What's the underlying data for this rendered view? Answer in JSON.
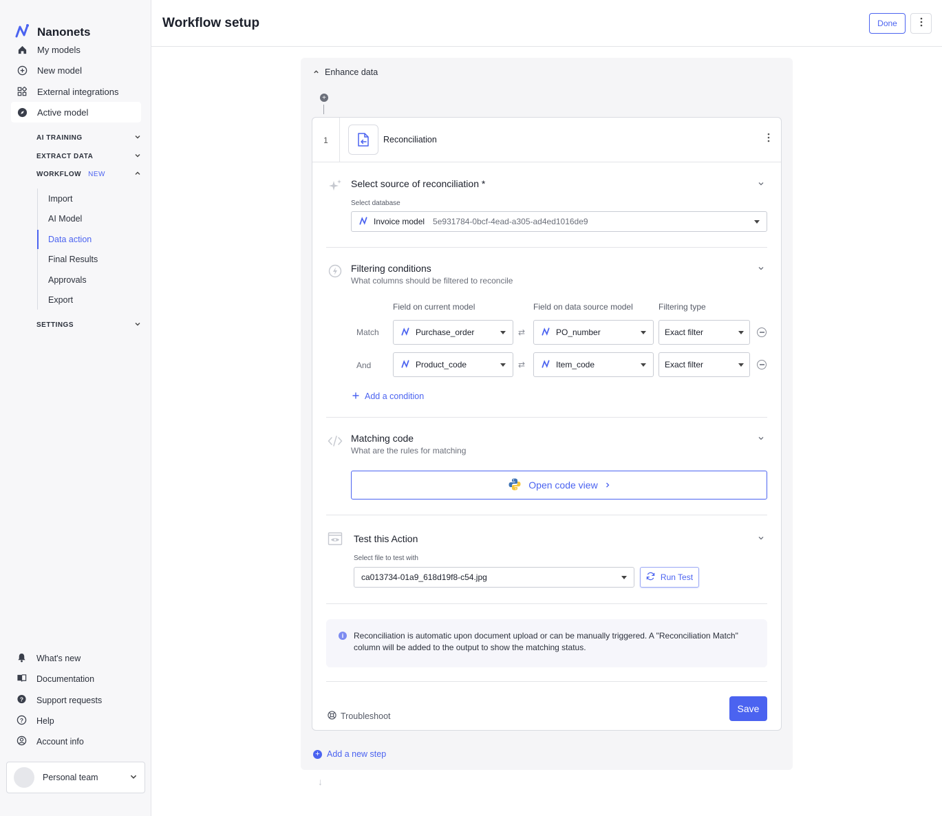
{
  "brand": {
    "name": "Nanonets"
  },
  "sidebar": {
    "items": [
      {
        "label": "My models",
        "icon": "home-icon"
      },
      {
        "label": "New model",
        "icon": "plus-circle-icon"
      },
      {
        "label": "External integrations",
        "icon": "grid-icon"
      },
      {
        "label": "Active model",
        "icon": "compass-icon"
      }
    ],
    "sections": {
      "ai_training": "AI TRAINING",
      "extract_data": "EXTRACT DATA",
      "workflow": "WORKFLOW",
      "workflow_badge": "NEW",
      "settings": "SETTINGS"
    },
    "workflow_items": [
      "Import",
      "AI Model",
      "Data action",
      "Final Results",
      "Approvals",
      "Export"
    ],
    "bottom": [
      {
        "label": "What's new",
        "icon": "bell-icon"
      },
      {
        "label": "Documentation",
        "icon": "book-icon"
      },
      {
        "label": "Support requests",
        "icon": "question-bubble-icon"
      },
      {
        "label": "Help",
        "icon": "help-icon"
      },
      {
        "label": "Account info",
        "icon": "user-circle-icon"
      }
    ],
    "team": "Personal team"
  },
  "header": {
    "title": "Workflow setup",
    "done": "Done"
  },
  "workflow": {
    "enhance": "Enhance data",
    "step": {
      "number": "1",
      "title": "Reconciliation"
    },
    "source": {
      "title": "Select source of reconciliation *",
      "label": "Select database",
      "db_name": "Invoice model",
      "db_id": "5e931784-0bcf-4ead-a305-ad4ed1016de9"
    },
    "filtering": {
      "title": "Filtering conditions",
      "subtitle": "What columns should be filtered to reconcile",
      "col_current": "Field on current model",
      "col_source": "Field on data source model",
      "col_type": "Filtering type",
      "rows": [
        {
          "label": "Match",
          "current": "Purchase_order",
          "source": "PO_number",
          "type": "Exact filter"
        },
        {
          "label": "And",
          "current": "Product_code",
          "source": "Item_code",
          "type": "Exact filter"
        }
      ],
      "add": "Add a condition"
    },
    "matching": {
      "title": "Matching code",
      "subtitle": "What are the rules for matching",
      "open": "Open code view"
    },
    "test": {
      "title": "Test this Action",
      "label": "Select file to test with",
      "file": "ca013734-01a9_618d19f8-c54.jpg",
      "run": "Run Test"
    },
    "info": "Reconciliation is automatic upon document upload or can be manually triggered. A \"Reconciliation Match\" column will be added to the output to show the matching status.",
    "troubleshoot": "Troubleshoot",
    "save": "Save",
    "add_step": "Add a new step"
  },
  "colors": {
    "accent": "#4b63f0"
  }
}
